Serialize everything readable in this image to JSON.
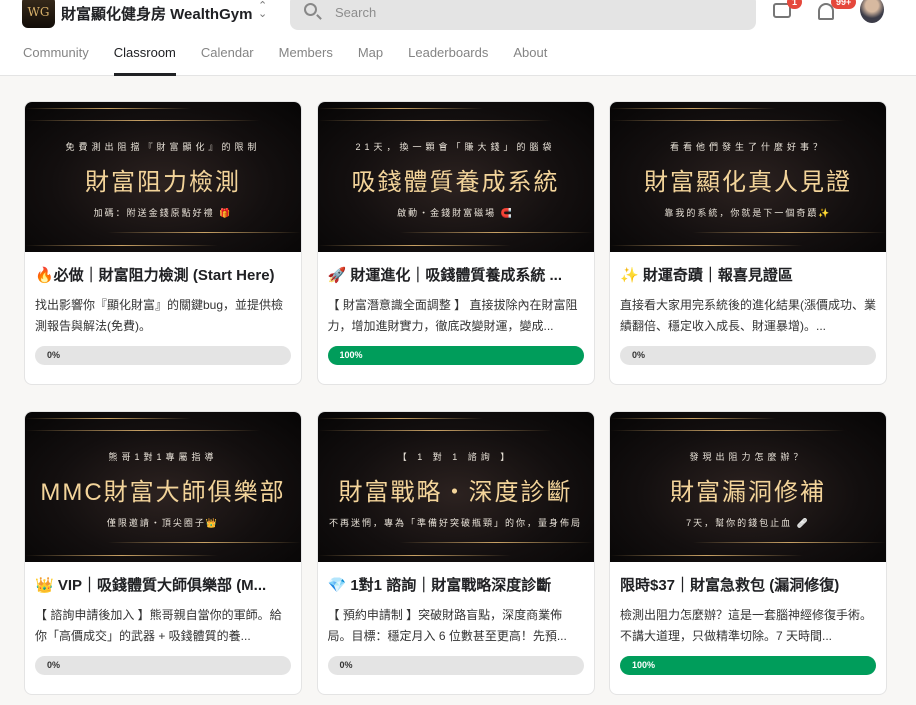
{
  "header": {
    "logo_text": "WG",
    "group_name": "財富顯化健身房 WealthGym",
    "search_placeholder": "Search",
    "chat_badge": "1",
    "notif_badge": "99+"
  },
  "tabs": [
    "Community",
    "Classroom",
    "Calendar",
    "Members",
    "Map",
    "Leaderboards",
    "About"
  ],
  "active_tab": "Classroom",
  "courses": [
    {
      "banner_top": "免費測出阻擋『財富顯化』的限制",
      "banner_title": "財富阻力檢測",
      "banner_bottom": "加碼：附送金錢原點好禮 🎁",
      "title": "🔥必做｜財富阻力檢測 (Start Here)",
      "description": "找出影響你『顯化財富』的關鍵bug，並提供檢測報告與解法(免費)。",
      "progress": 0,
      "progress_label": "0%"
    },
    {
      "banner_top": "21天，換一顆會「賺大錢」的腦袋",
      "banner_title": "吸錢體質養成系統",
      "banner_bottom": "啟動・金錢財富磁場 🧲",
      "title": "🚀 財運進化｜吸錢體質養成系統 ...",
      "description": "【 財富潛意識全面調整 】 直接拔除內在財富阻力，增加進財實力，徹底改變財運，變成...",
      "progress": 100,
      "progress_label": "100%"
    },
    {
      "banner_top": "看看他們發生了什麼好事？",
      "banner_title": "財富顯化真人見證",
      "banner_bottom": "靠我的系統，你就是下一個奇蹟✨",
      "title": "✨ 財運奇蹟｜報喜見證區",
      "description": "直接看大家用完系統後的進化結果(漲價成功、業績翻倍、穩定收入成長、財運暴增)。...",
      "progress": 0,
      "progress_label": "0%"
    },
    {
      "banner_top": "熊哥1對1專屬指導",
      "banner_title": "MMC財富大師俱樂部",
      "banner_bottom": "僅限邀請・頂尖圈子👑",
      "title": "👑 VIP｜吸錢體質大師俱樂部 (M...",
      "description": "【 諮詢申請後加入 】熊哥親自當你的軍師。給你「高價成交」的武器 + 吸錢體質的養...",
      "progress": 0,
      "progress_label": "0%"
    },
    {
      "banner_top": "【 1 對 1 諮詢 】",
      "banner_title": "財富戰略・深度診斷",
      "banner_bottom": "不再迷惘，專為「準備好突破瓶頸」的你，量身佈局",
      "title": "💎 1對1 諮詢｜財富戰略深度診斷",
      "description": "【 預約申請制 】突破財路盲點，深度商業佈局。目標：穩定月入 6 位數甚至更高！先預...",
      "progress": 0,
      "progress_label": "0%"
    },
    {
      "banner_top": "發現出阻力怎麼辦？",
      "banner_title": "財富漏洞修補",
      "banner_bottom": "7天，幫你的錢包止血 🩹",
      "title": "限時$37｜財富急救包 (漏洞修復)",
      "description": "檢測出阻力怎麼辦？這是一套腦神經修復手術。 不講大道理，只做精準切除。7 天時間...",
      "progress": 100,
      "progress_label": "100%"
    }
  ]
}
